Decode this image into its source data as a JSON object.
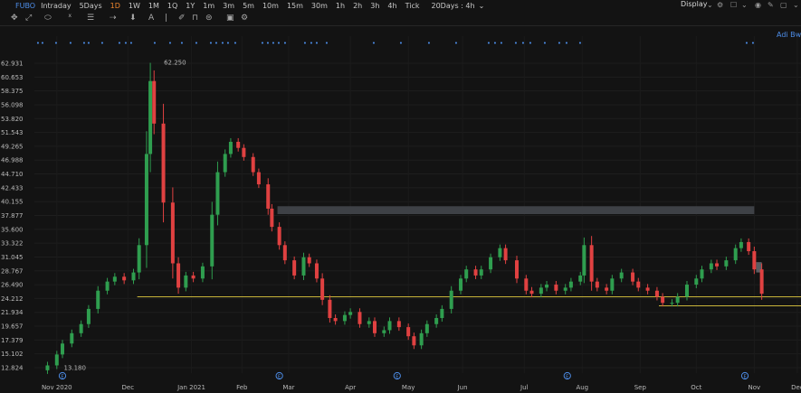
{
  "header": {
    "symbol": "FUBO",
    "timeframes": [
      "Intraday",
      "5Days",
      "1D",
      "1W",
      "1M",
      "1Q",
      "1Y",
      "1m",
      "3m",
      "5m",
      "10m",
      "15m",
      "30m",
      "1h",
      "2h",
      "3h",
      "4h",
      "Tick"
    ],
    "active_timeframe": "1D",
    "range_selector": "20Days : 4h",
    "display_label": "Display",
    "user": "Adi Bw"
  },
  "toolbar_icons": [
    "crosshair-icon",
    "trendline-icon",
    "shape-icon",
    "indicator-icon",
    "layers-icon",
    "arrow-tool-icon",
    "text-tool-icon",
    "eraser-icon",
    "magnet-icon",
    "lock-icon",
    "hide-icon",
    "settings-icon"
  ],
  "chart_data": {
    "type": "candlestick",
    "y_ticks": [
      62.931,
      60.653,
      58.375,
      56.098,
      53.82,
      51.543,
      49.265,
      46.988,
      44.71,
      42.433,
      40.155,
      37.877,
      35.6,
      33.322,
      31.045,
      28.767,
      26.49,
      24.212,
      21.934,
      19.657,
      17.379,
      15.102,
      12.824
    ],
    "x_tick_labels": [
      "Nov 2020",
      "Dec",
      "Jan 2021",
      "Feb",
      "Mar",
      "Apr",
      "May",
      "Jun",
      "Jul",
      "Aug",
      "Sep",
      "Oct",
      "Nov",
      "Dec"
    ],
    "high_label": "62.250",
    "low_label": "13.180",
    "horizontal_lines": [
      {
        "price": 24.5,
        "color": "#c9b53a",
        "from": "Dec 16"
      },
      {
        "price": 23.0,
        "color": "#c9b53a",
        "from": "Sep 21"
      }
    ],
    "zones": [
      {
        "from": "Mar 1",
        "to": "Nov 11",
        "low": 38.1,
        "high": 39.4,
        "color": "#3e4146"
      },
      {
        "from": "Nov 12",
        "to": "Nov 15",
        "low": 28.5,
        "high": 30.2,
        "color": "#5a5d62"
      }
    ],
    "event_markers": [
      "Nov 2020",
      "Mar",
      "May",
      "Aug",
      "Nov"
    ],
    "up_color": "#2f9e4f",
    "down_color": "#e04141",
    "candles": [
      {
        "date": "2020-10-29",
        "close": 13.2
      },
      {
        "date": "2020-11-03",
        "close": 15.0
      },
      {
        "date": "2020-11-06",
        "close": 16.8
      },
      {
        "date": "2020-11-11",
        "close": 18.5
      },
      {
        "date": "2020-11-16",
        "close": 20.0
      },
      {
        "date": "2020-11-20",
        "close": 22.5
      },
      {
        "date": "2020-11-25",
        "close": 25.5
      },
      {
        "date": "2020-11-30",
        "close": 27.0
      },
      {
        "date": "2020-12-04",
        "close": 27.8
      },
      {
        "date": "2020-12-09",
        "close": 27.2
      },
      {
        "date": "2020-12-14",
        "close": 28.5
      },
      {
        "date": "2020-12-17",
        "close": 33.0
      },
      {
        "date": "2020-12-21",
        "close": 48.0
      },
      {
        "date": "2020-12-23",
        "close": 60.0
      },
      {
        "date": "2020-12-25",
        "close": 53.0
      },
      {
        "date": "2020-12-30",
        "close": 40.0
      },
      {
        "date": "2021-01-04",
        "close": 30.0
      },
      {
        "date": "2021-01-07",
        "close": 26.0
      },
      {
        "date": "2021-01-11",
        "close": 28.0
      },
      {
        "date": "2021-01-15",
        "close": 27.5
      },
      {
        "date": "2021-01-20",
        "close": 29.5
      },
      {
        "date": "2021-01-25",
        "close": 38.0
      },
      {
        "date": "2021-01-28",
        "close": 45.0
      },
      {
        "date": "2021-02-01",
        "close": 48.0
      },
      {
        "date": "2021-02-04",
        "close": 50.0
      },
      {
        "date": "2021-02-08",
        "close": 49.0
      },
      {
        "date": "2021-02-11",
        "close": 47.5
      },
      {
        "date": "2021-02-16",
        "close": 45.0
      },
      {
        "date": "2021-02-19",
        "close": 43.0
      },
      {
        "date": "2021-02-24",
        "close": 39.0
      },
      {
        "date": "2021-02-26",
        "close": 36.0
      },
      {
        "date": "2021-03-02",
        "close": 33.0
      },
      {
        "date": "2021-03-05",
        "close": 30.5
      },
      {
        "date": "2021-03-10",
        "close": 28.0
      },
      {
        "date": "2021-03-15",
        "close": 31.0
      },
      {
        "date": "2021-03-18",
        "close": 30.0
      },
      {
        "date": "2021-03-22",
        "close": 27.5
      },
      {
        "date": "2021-03-25",
        "close": 24.0
      },
      {
        "date": "2021-03-29",
        "close": 21.0
      },
      {
        "date": "2021-04-01",
        "close": 20.5
      },
      {
        "date": "2021-04-06",
        "close": 21.5
      },
      {
        "date": "2021-04-09",
        "close": 22.0
      },
      {
        "date": "2021-04-14",
        "close": 20.0
      },
      {
        "date": "2021-04-19",
        "close": 20.5
      },
      {
        "date": "2021-04-22",
        "close": 18.5
      },
      {
        "date": "2021-04-27",
        "close": 19.0
      },
      {
        "date": "2021-04-30",
        "close": 20.5
      },
      {
        "date": "2021-05-05",
        "close": 19.5
      },
      {
        "date": "2021-05-10",
        "close": 18.0
      },
      {
        "date": "2021-05-13",
        "close": 16.5
      },
      {
        "date": "2021-05-17",
        "close": 18.5
      },
      {
        "date": "2021-05-20",
        "close": 20.0
      },
      {
        "date": "2021-05-25",
        "close": 21.0
      },
      {
        "date": "2021-05-28",
        "close": 22.5
      },
      {
        "date": "2021-06-02",
        "close": 25.5
      },
      {
        "date": "2021-06-07",
        "close": 27.5
      },
      {
        "date": "2021-06-10",
        "close": 29.0
      },
      {
        "date": "2021-06-15",
        "close": 28.0
      },
      {
        "date": "2021-06-18",
        "close": 29.0
      },
      {
        "date": "2021-06-23",
        "close": 31.0
      },
      {
        "date": "2021-06-28",
        "close": 32.5
      },
      {
        "date": "2021-07-01",
        "close": 30.5
      },
      {
        "date": "2021-07-07",
        "close": 27.5
      },
      {
        "date": "2021-07-12",
        "close": 25.5
      },
      {
        "date": "2021-07-15",
        "close": 25.0
      },
      {
        "date": "2021-07-20",
        "close": 26.0
      },
      {
        "date": "2021-07-23",
        "close": 26.5
      },
      {
        "date": "2021-07-28",
        "close": 25.5
      },
      {
        "date": "2021-08-02",
        "close": 26.0
      },
      {
        "date": "2021-08-05",
        "close": 27.0
      },
      {
        "date": "2021-08-10",
        "close": 28.0
      },
      {
        "date": "2021-08-12",
        "close": 33.0
      },
      {
        "date": "2021-08-16",
        "close": 27.0
      },
      {
        "date": "2021-08-19",
        "close": 26.0
      },
      {
        "date": "2021-08-24",
        "close": 25.5
      },
      {
        "date": "2021-08-27",
        "close": 27.5
      },
      {
        "date": "2021-09-01",
        "close": 28.5
      },
      {
        "date": "2021-09-07",
        "close": 27.0
      },
      {
        "date": "2021-09-10",
        "close": 26.0
      },
      {
        "date": "2021-09-15",
        "close": 25.5
      },
      {
        "date": "2021-09-20",
        "close": 24.5
      },
      {
        "date": "2021-09-23",
        "close": 23.5
      },
      {
        "date": "2021-09-28",
        "close": 23.5
      },
      {
        "date": "2021-10-01",
        "close": 24.5
      },
      {
        "date": "2021-10-06",
        "close": 26.5
      },
      {
        "date": "2021-10-11",
        "close": 27.5
      },
      {
        "date": "2021-10-14",
        "close": 29.0
      },
      {
        "date": "2021-10-19",
        "close": 30.0
      },
      {
        "date": "2021-10-22",
        "close": 29.5
      },
      {
        "date": "2021-10-27",
        "close": 30.5
      },
      {
        "date": "2021-11-01",
        "close": 32.5
      },
      {
        "date": "2021-11-04",
        "close": 33.5
      },
      {
        "date": "2021-11-08",
        "close": 32.0
      },
      {
        "date": "2021-11-11",
        "close": 29.0
      },
      {
        "date": "2021-11-15",
        "close": 25.0
      }
    ]
  }
}
